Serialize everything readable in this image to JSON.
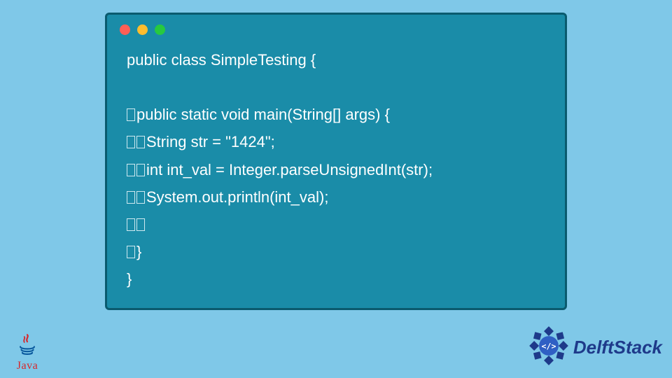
{
  "window": {
    "dots": [
      "red",
      "yellow",
      "green"
    ]
  },
  "code": {
    "lines": [
      {
        "indent": 0,
        "text": "public class SimpleTesting {"
      },
      {
        "indent": 0,
        "text": ""
      },
      {
        "indent": 1,
        "text": "public static void main(String[] args) {"
      },
      {
        "indent": 2,
        "text": "String str = \"1424\";"
      },
      {
        "indent": 2,
        "text": "int int_val = Integer.parseUnsignedInt(str);"
      },
      {
        "indent": 2,
        "text": "System.out.println(int_val);"
      },
      {
        "indent": 2,
        "text": ""
      },
      {
        "indent": 1,
        "text": "}"
      },
      {
        "indent": 0,
        "text": "}"
      }
    ]
  },
  "branding": {
    "java_label": "Java",
    "delft_label": "DelftStack"
  },
  "colors": {
    "page_bg": "#7fc8e8",
    "window_bg": "#1a8ca8",
    "window_border": "#0a5a6e",
    "code_text": "#ffffff",
    "dot_red": "#ff5f56",
    "dot_yellow": "#ffbd2e",
    "dot_green": "#27c93f",
    "java_red": "#d8262a",
    "delft_blue": "#1e3a8a"
  }
}
